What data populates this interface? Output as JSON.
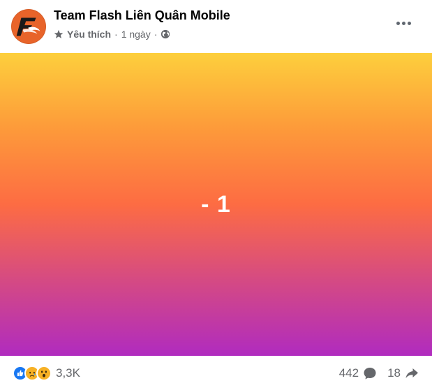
{
  "post": {
    "page_name": "Team Flash Liên Quân Mobile",
    "status_label": "Yêu thích",
    "separator": "·",
    "time": "1 ngày",
    "avatar_text": "F",
    "content_text": "- 1",
    "gradient_colors": [
      "#fdcf3c",
      "#fd6c43",
      "#b02bbf"
    ]
  },
  "engagement": {
    "reaction_icons": [
      "like-reaction-icon",
      "sad-reaction-icon",
      "wow-reaction-icon"
    ],
    "reaction_count": "3,3K",
    "comment_count": "442",
    "share_count": "18"
  }
}
